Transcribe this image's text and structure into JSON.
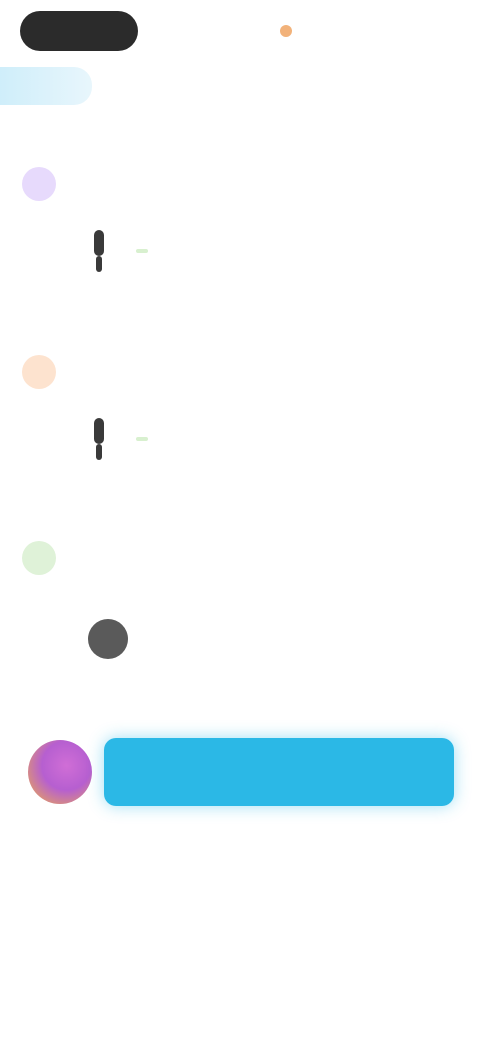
{
  "colors": {
    "tab_active_bg": "#2b2b2b",
    "header_accent": "#cfeefa",
    "section1_icon": "#e7dafc",
    "section2_icon": "#fde3cf",
    "section3_icon": "#dff2d8",
    "badge_green": "#d8f0cf",
    "cta": "#2bb8e6"
  },
  "tabs": [
    {
      "label": ""
    },
    {
      "label": ""
    },
    {
      "label": ""
    }
  ],
  "header": {
    "title": ""
  },
  "sections": [
    {
      "title": "",
      "subtitle": "",
      "badge": "",
      "value": ""
    },
    {
      "title": "",
      "subtitle": "",
      "badge": "",
      "value": ""
    },
    {
      "title": "",
      "subtitle": "",
      "badge": "",
      "value": ""
    }
  ],
  "cta": {
    "label": ""
  }
}
